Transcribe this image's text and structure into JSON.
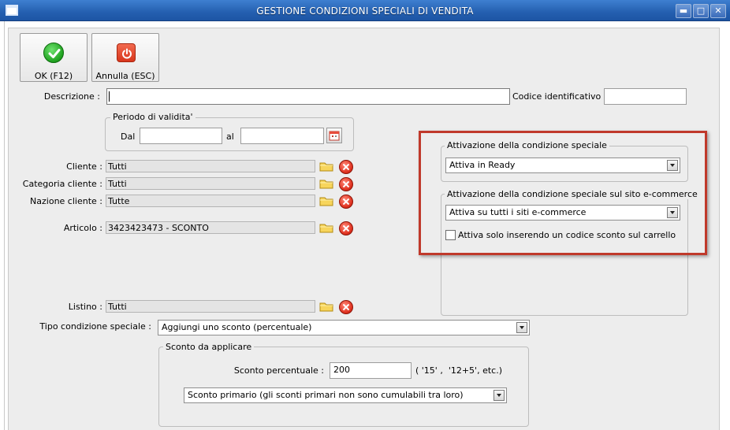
{
  "window": {
    "title": "GESTIONE CONDIZIONI SPECIALI DI VENDITA",
    "minimize": "▬",
    "maximize": "□",
    "close": "✕"
  },
  "toolbar": {
    "ok_label": "OK (F12)",
    "cancel_label": "Annulla (ESC)"
  },
  "form": {
    "descrizione_label": "Descrizione :",
    "descrizione_value": "",
    "codice_label": "Codice identificativo :",
    "codice_value": "",
    "periodo": {
      "legend": "Periodo di validita'",
      "dal_label": "Dal",
      "dal_value": "",
      "al_label": "al",
      "al_value": ""
    },
    "cliente_label": "Cliente :",
    "cliente_value": "Tutti",
    "categoria_label": "Categoria cliente :",
    "categoria_value": "Tutti",
    "nazione_label": "Nazione cliente :",
    "nazione_value": "Tutte",
    "articolo_label": "Articolo :",
    "articolo_value": "3423423473 - SCONTO",
    "listino_label": "Listino :",
    "listino_value": "Tutti",
    "tipo_label": "Tipo condizione speciale :",
    "tipo_value": "Aggiungi uno sconto (percentuale)"
  },
  "sconto": {
    "legend": "Sconto da applicare",
    "percent_label": "Sconto percentuale :",
    "percent_value": "200",
    "hint": "( '15' ,  '12+5', etc.)",
    "primario_value": "Sconto primario (gli sconti primari non sono cumulabili tra loro)"
  },
  "attivazione": {
    "legend": "Attivazione della condizione speciale",
    "value": "Attiva in Ready"
  },
  "ecommerce": {
    "legend": "Attivazione della condizione speciale sul sito e-commerce",
    "value": "Attiva su tutti i siti e-commerce",
    "checkbox_label": "Attiva solo inserendo un codice sconto sul carrello",
    "checkbox_checked": false
  },
  "colors": {
    "titlebar": "#245fb0",
    "highlight_box": "#c0392b"
  }
}
